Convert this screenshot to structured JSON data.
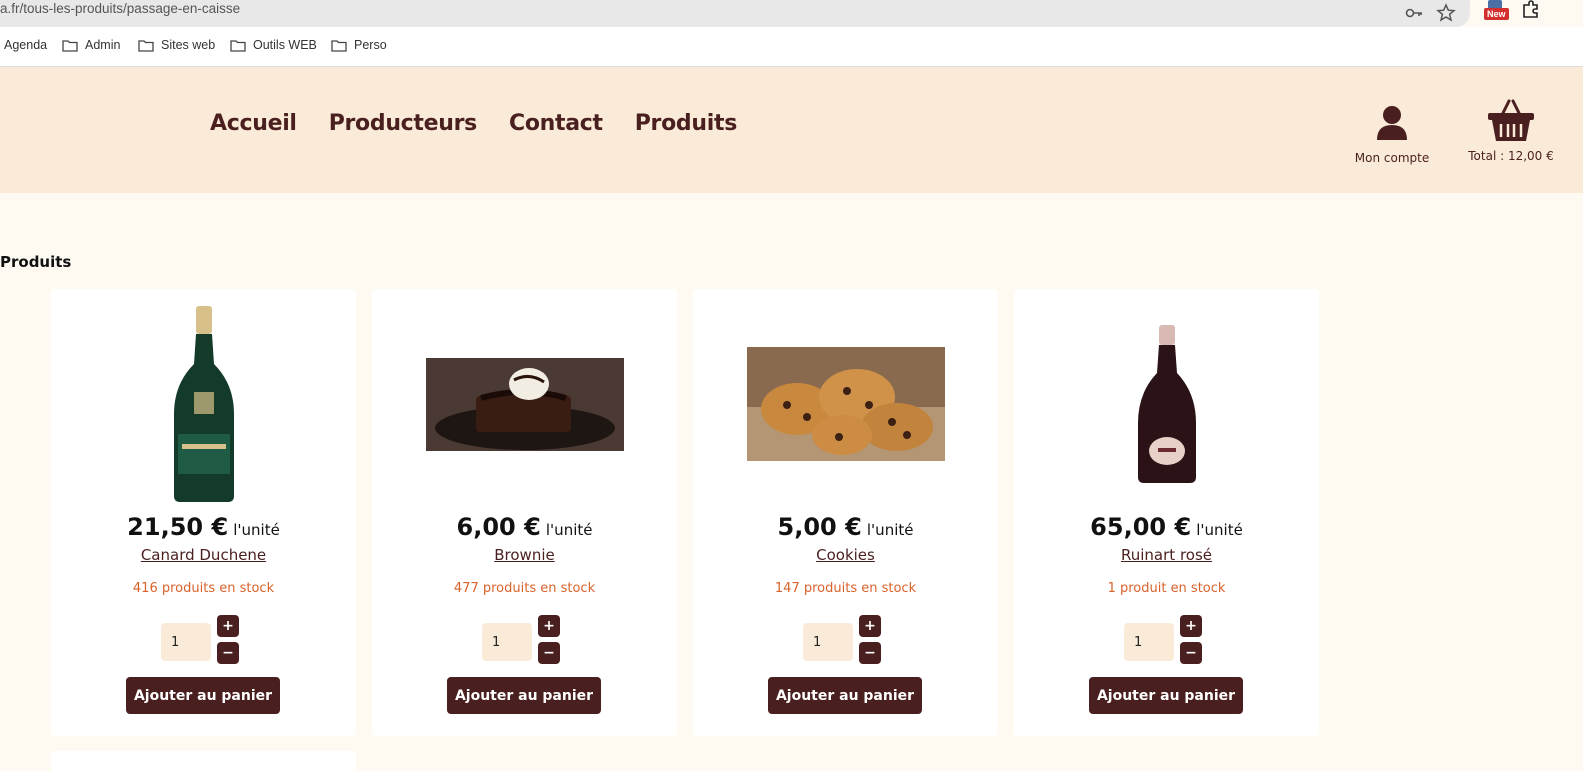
{
  "browser": {
    "url": "a.fr/tous-les-produits/passage-en-caisse",
    "new_badge": "New",
    "bookmarks": [
      "Agenda",
      "Admin",
      "Sites web",
      "Outils WEB",
      "Perso"
    ]
  },
  "header": {
    "nav": [
      "Accueil",
      "Producteurs",
      "Contact",
      "Produits"
    ],
    "account_label": "Mon compte",
    "cart_label": "Total : 12,00 €"
  },
  "section_title": "Produits",
  "products": [
    {
      "price": "21,50 €",
      "unit": "l'unité",
      "name": "Canard Duchene",
      "stock": "416 produits en stock",
      "qty": "1",
      "button": "Ajouter au panier",
      "image": "champagne-bottle-green"
    },
    {
      "price": "6,00 €",
      "unit": "l'unité",
      "name": "Brownie",
      "stock": "477 produits en stock",
      "qty": "1",
      "button": "Ajouter au panier",
      "image": "brownie-with-ice-cream"
    },
    {
      "price": "5,00 €",
      "unit": "l'unité",
      "name": "Cookies",
      "stock": "147 produits en stock",
      "qty": "1",
      "button": "Ajouter au panier",
      "image": "chocolate-chip-cookies"
    },
    {
      "price": "65,00 €",
      "unit": "l'unité",
      "name": "Ruinart rosé",
      "stock": "1 produit en stock",
      "qty": "1",
      "button": "Ajouter au panier",
      "image": "rose-champagne-bottle"
    }
  ],
  "stepper": {
    "plus": "+",
    "minus": "−"
  },
  "colors": {
    "brand": "#4a1f1f",
    "header_bg": "#faebd8",
    "page_bg": "#fffaf1",
    "stock": "#d9622b"
  }
}
